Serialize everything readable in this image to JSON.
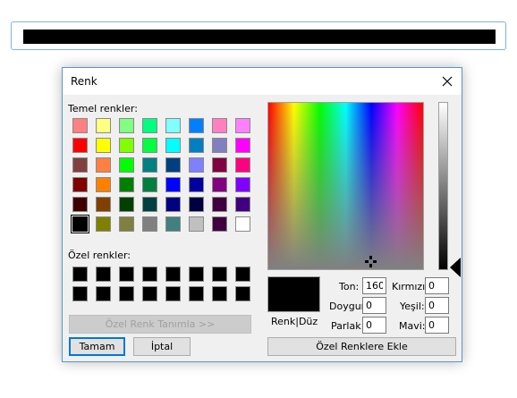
{
  "dialog": {
    "title": "Renk",
    "basic_colors_label": "Temel renkler:",
    "custom_colors_label": "Özel renkler:",
    "define_custom_button": "Özel Renk Tanımla >>",
    "ok_button": "Tamam",
    "cancel_button": "İptal",
    "solid_label": "Renk|Düz",
    "add_custom_button": "Özel Renklere Ekle",
    "fields": {
      "hue": {
        "label": "Ton:",
        "value": "160"
      },
      "sat": {
        "label": "Doygun:",
        "value": "0"
      },
      "lum": {
        "label": "Parlak:",
        "value": "0"
      },
      "red": {
        "label": "Kırmızı:",
        "value": "0"
      },
      "green": {
        "label": "Yeşil:",
        "value": "0"
      },
      "blue": {
        "label": "Mavi:",
        "value": "0"
      }
    }
  },
  "current_color": "#000000",
  "basic_colors": [
    [
      "#ff8080",
      "#ffff80",
      "#80ff80",
      "#00ff80",
      "#80ffff",
      "#0080ff",
      "#ff80c0",
      "#ff80ff"
    ],
    [
      "#ff0000",
      "#ffff00",
      "#80ff00",
      "#00ff40",
      "#00ffff",
      "#0080c0",
      "#8080c0",
      "#ff00ff"
    ],
    [
      "#804040",
      "#ff8040",
      "#00ff00",
      "#008080",
      "#004080",
      "#8080ff",
      "#800040",
      "#ff0080"
    ],
    [
      "#800000",
      "#ff8000",
      "#008000",
      "#008040",
      "#0000ff",
      "#0000a0",
      "#800080",
      "#8000ff"
    ],
    [
      "#400000",
      "#804000",
      "#004000",
      "#004040",
      "#000080",
      "#000040",
      "#400040",
      "#400080"
    ],
    [
      "#000000",
      "#808000",
      "#808040",
      "#808080",
      "#408080",
      "#c0c0c0",
      "#400040",
      "#ffffff"
    ]
  ],
  "selected_basic": [
    5,
    0
  ],
  "custom_colors": [
    [
      "#000000",
      "#000000",
      "#000000",
      "#000000",
      "#000000",
      "#000000",
      "#000000",
      "#000000"
    ],
    [
      "#000000",
      "#000000",
      "#000000",
      "#000000",
      "#000000",
      "#000000",
      "#000000",
      "#000000"
    ]
  ]
}
